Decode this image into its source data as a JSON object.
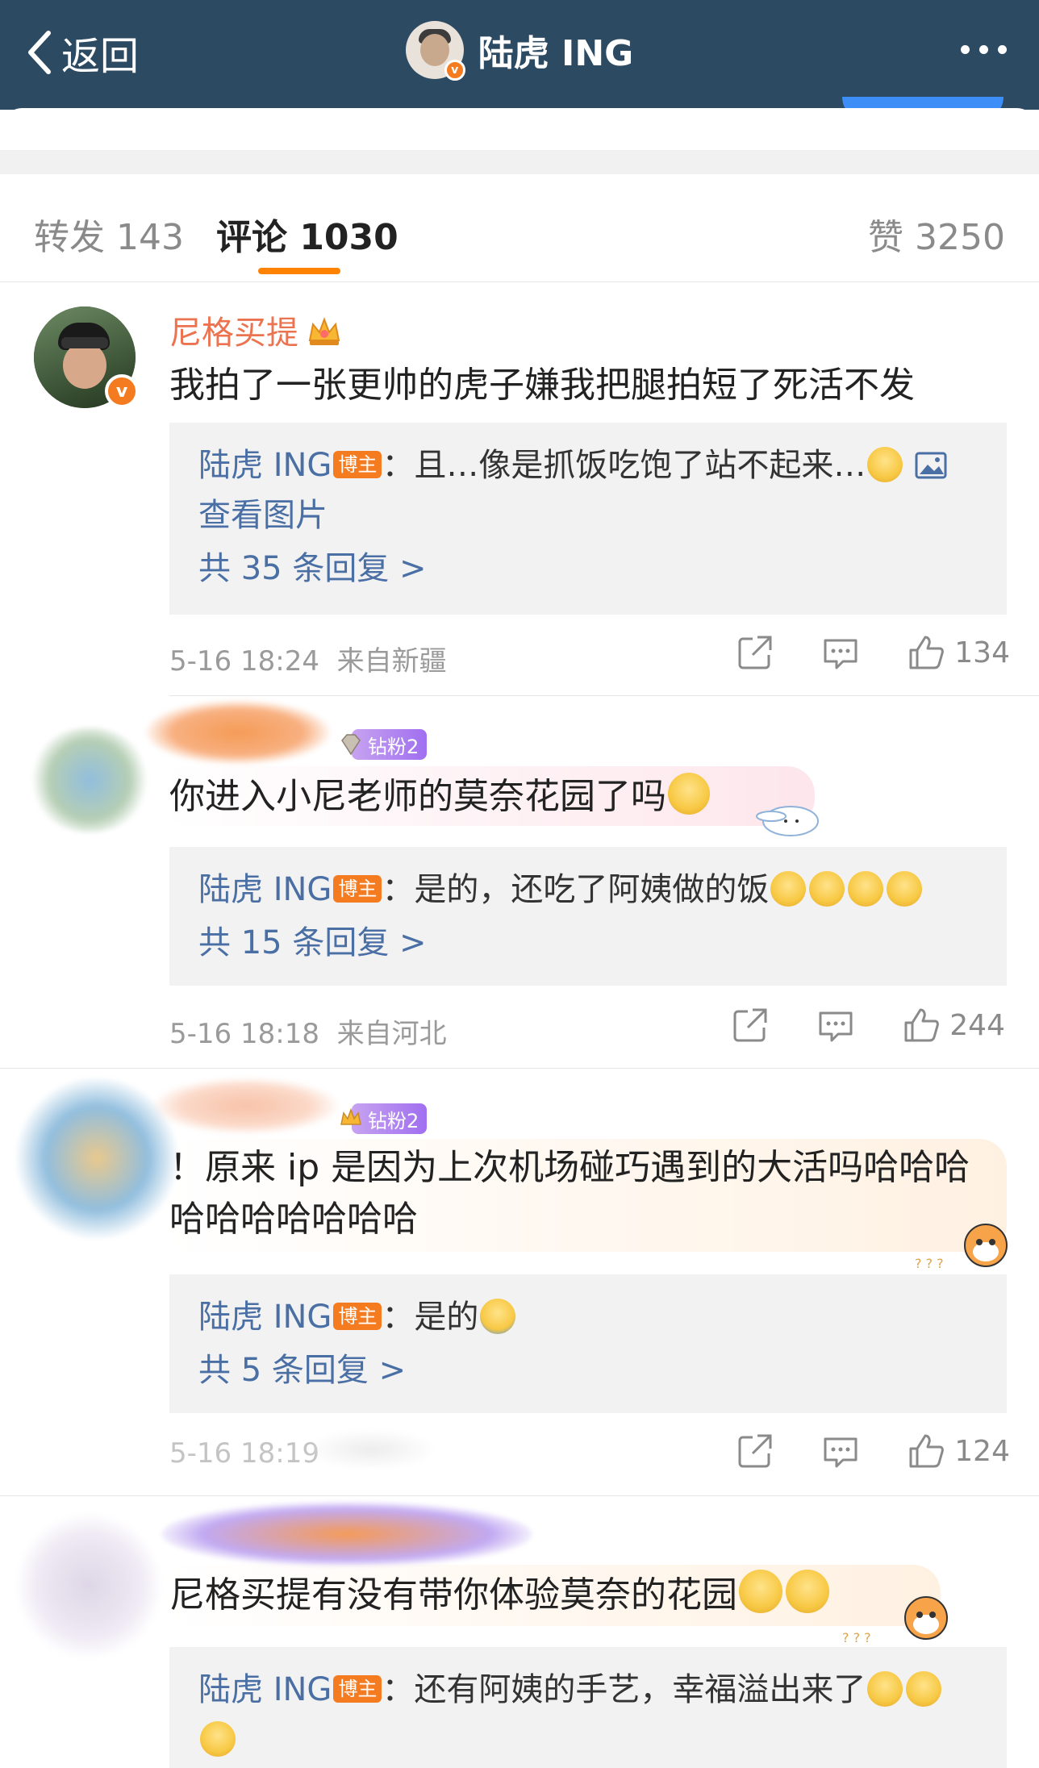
{
  "header": {
    "back_label": "返回",
    "title": "陆虎 ING"
  },
  "tabs": {
    "repost": "转发 143",
    "comment": "评论 1030",
    "like": "赞 3250"
  },
  "comments": [
    {
      "nickname": "尼格买提",
      "text": "我拍了一张更帅的虎子嫌我把腿拍短了死活不发",
      "reply_author": "陆虎 ING",
      "reply_badge": "博主",
      "reply_text": "：且…像是抓饭吃饱了站不起来…",
      "reply_extra": "查看图片",
      "more_replies": "共 35 条回复 >",
      "time": "5-16 18:24",
      "location": "来自新疆",
      "likes": "134"
    },
    {
      "fan_badge": "钻粉2",
      "text": "你进入小尼老师的莫奈花园了吗",
      "reply_author": "陆虎 ING",
      "reply_badge": "博主",
      "reply_text": "：是的，还吃了阿姨做的饭",
      "more_replies": "共 15 条回复 >",
      "time": "5-16 18:18",
      "location": "来自河北",
      "likes": "244"
    },
    {
      "fan_badge": "钻粉2",
      "text_line1": "！原来 ip 是因为上次机场碰巧遇到的大活吗哈哈哈",
      "text_line2": "哈哈哈哈哈哈哈",
      "reply_author": "陆虎 ING",
      "reply_badge": "博主",
      "reply_text": "：是的",
      "more_replies": "共 5 条回复 >",
      "time": "5-16 18:19",
      "likes": "124"
    },
    {
      "text": "尼格买提有没有带你体验莫奈的花园",
      "reply_author": "陆虎 ING",
      "reply_badge": "博主",
      "reply_text": "：还有阿姨的手艺，幸福溢出来了"
    }
  ],
  "colors": {
    "header_bg": "#2d4a63",
    "accent_orange": "#ff8200",
    "link_blue": "#4a6fa5",
    "nickname_orange": "#eb7350"
  }
}
